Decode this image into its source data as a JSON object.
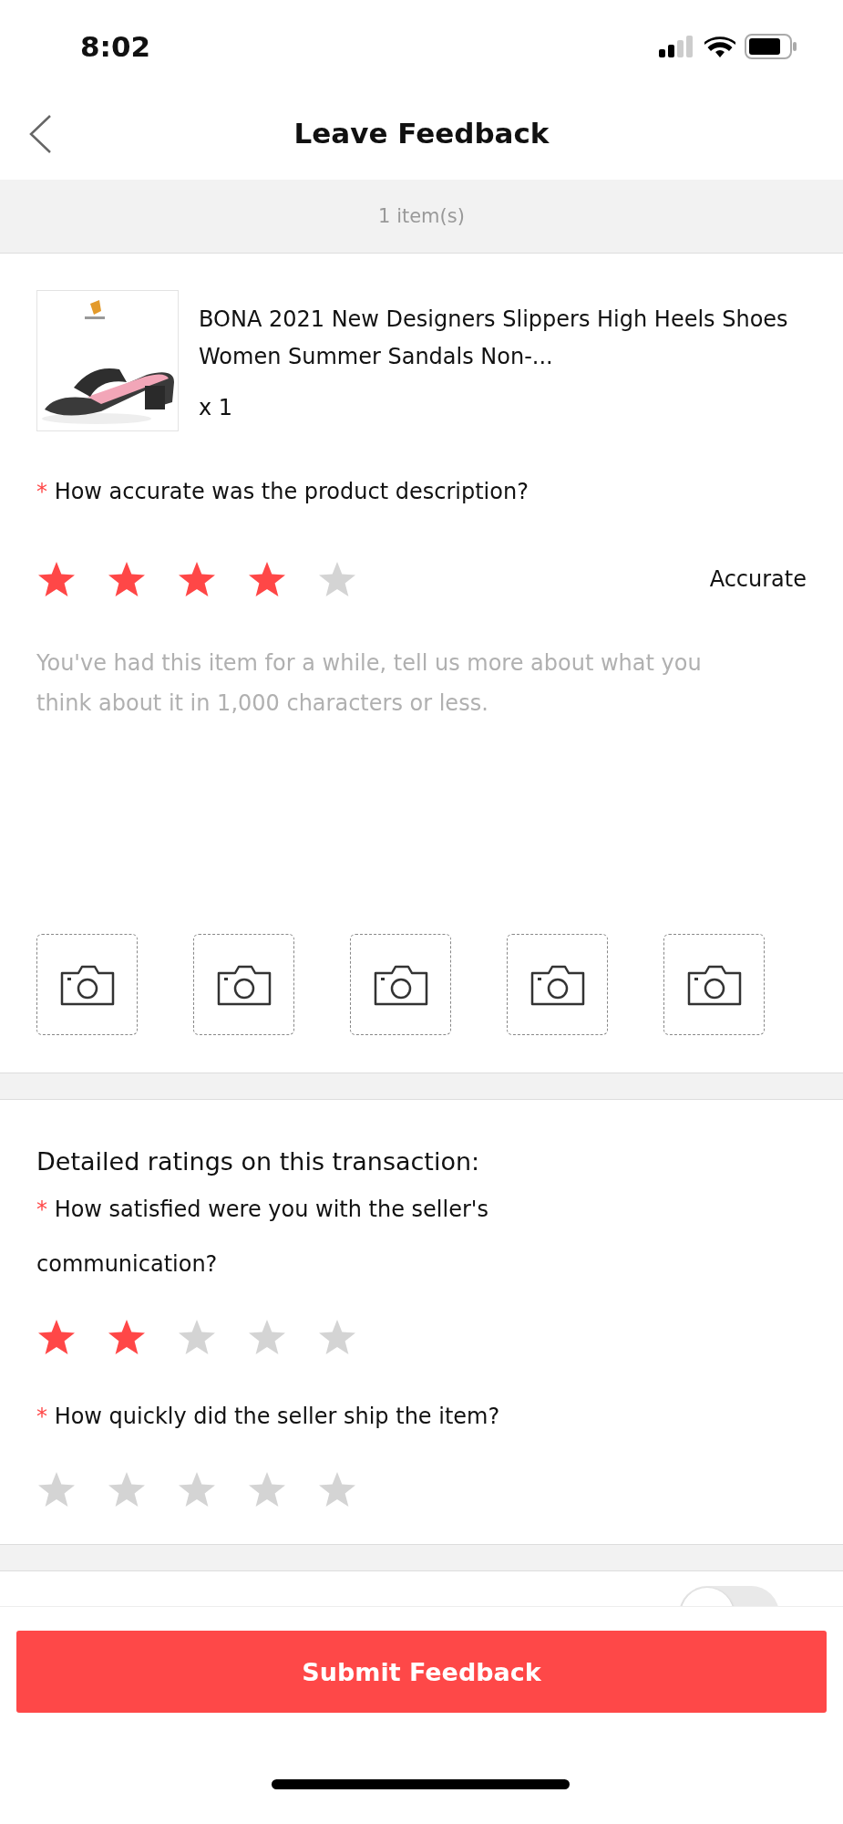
{
  "status_bar": {
    "time": "8:02"
  },
  "header": {
    "title": "Leave Feedback"
  },
  "item_count": "1 item(s)",
  "product": {
    "title": "BONA 2021 New Designers Slippers High Heels Shoes Women Summer Sandals Non-...",
    "quantity": "x 1"
  },
  "main_rating": {
    "required_mark": "*",
    "question": "How accurate was the product description?",
    "stars": 4,
    "verdict": "Accurate"
  },
  "comment": {
    "placeholder": "You've had this item for a while, tell us more about what you think about it in 1,000 characters or less."
  },
  "photo_slots": [
    {
      "kind": "camera"
    },
    {
      "kind": "camera"
    },
    {
      "kind": "camera"
    },
    {
      "kind": "camera"
    },
    {
      "kind": "camera"
    }
  ],
  "detailed": {
    "heading": "Detailed ratings on this transaction:",
    "questions": [
      {
        "required_mark": "*",
        "question": "How satisfied were you with the seller's communication?",
        "stars": 2
      },
      {
        "required_mark": "*",
        "question": "How quickly did the seller ship the item?",
        "stars": 0
      }
    ]
  },
  "anonymous_toggle": {
    "on": false
  },
  "submit_button": "Submit Feedback"
}
